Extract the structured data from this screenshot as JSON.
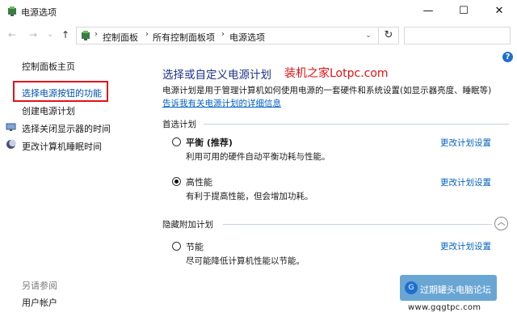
{
  "window": {
    "title": "电源选项",
    "minimize": "—",
    "maximize": "☐",
    "close": "✕"
  },
  "navbar": {
    "back": "←",
    "forward": "→",
    "recent": "⌄",
    "up": "↑",
    "breadcrumb": [
      "控制面板",
      "所有控制面板项",
      "电源选项"
    ],
    "separator": "›",
    "dropdown": "⌄",
    "refresh": "↻",
    "search_value": ""
  },
  "sidebar": {
    "items": [
      {
        "label": "控制面板主页"
      },
      {
        "label": "选择电源按钮的功能"
      },
      {
        "label": "创建电源计划"
      },
      {
        "label": "选择关闭显示器的时间"
      },
      {
        "label": "更改计算机睡眠时间"
      }
    ],
    "see_also_title": "另请参阅",
    "see_also_items": [
      {
        "label": "用户帐户"
      }
    ]
  },
  "help": "?",
  "main": {
    "title": "选择或自定义电源计划",
    "watermark": "装机之家Lotpc.com",
    "description": "电源计划是用于管理计算机如何使用电源的一套硬件和系统设置(如显示器亮度、睡眠等)",
    "description_link": "告诉我有关电源计划的详细信息",
    "preferred_section": "首选计划",
    "hidden_section": "隐藏附加计划",
    "collapse": "︿",
    "plans": [
      {
        "name": "平衡 (推荐)",
        "desc": "利用可用的硬件自动平衡功耗与性能。",
        "link": "更改计划设置",
        "selected": false
      },
      {
        "name": "高性能",
        "desc": "有利于提高性能，但会增加功耗。",
        "link": "更改计划设置",
        "selected": true
      },
      {
        "name": "节能",
        "desc": "尽可能降低计算机性能以节能。",
        "link": "更改计划设置",
        "selected": false
      }
    ]
  },
  "badge": {
    "logo": "G",
    "text": "过期罐头电脑论坛",
    "url": "www.gqgtpc.com"
  }
}
